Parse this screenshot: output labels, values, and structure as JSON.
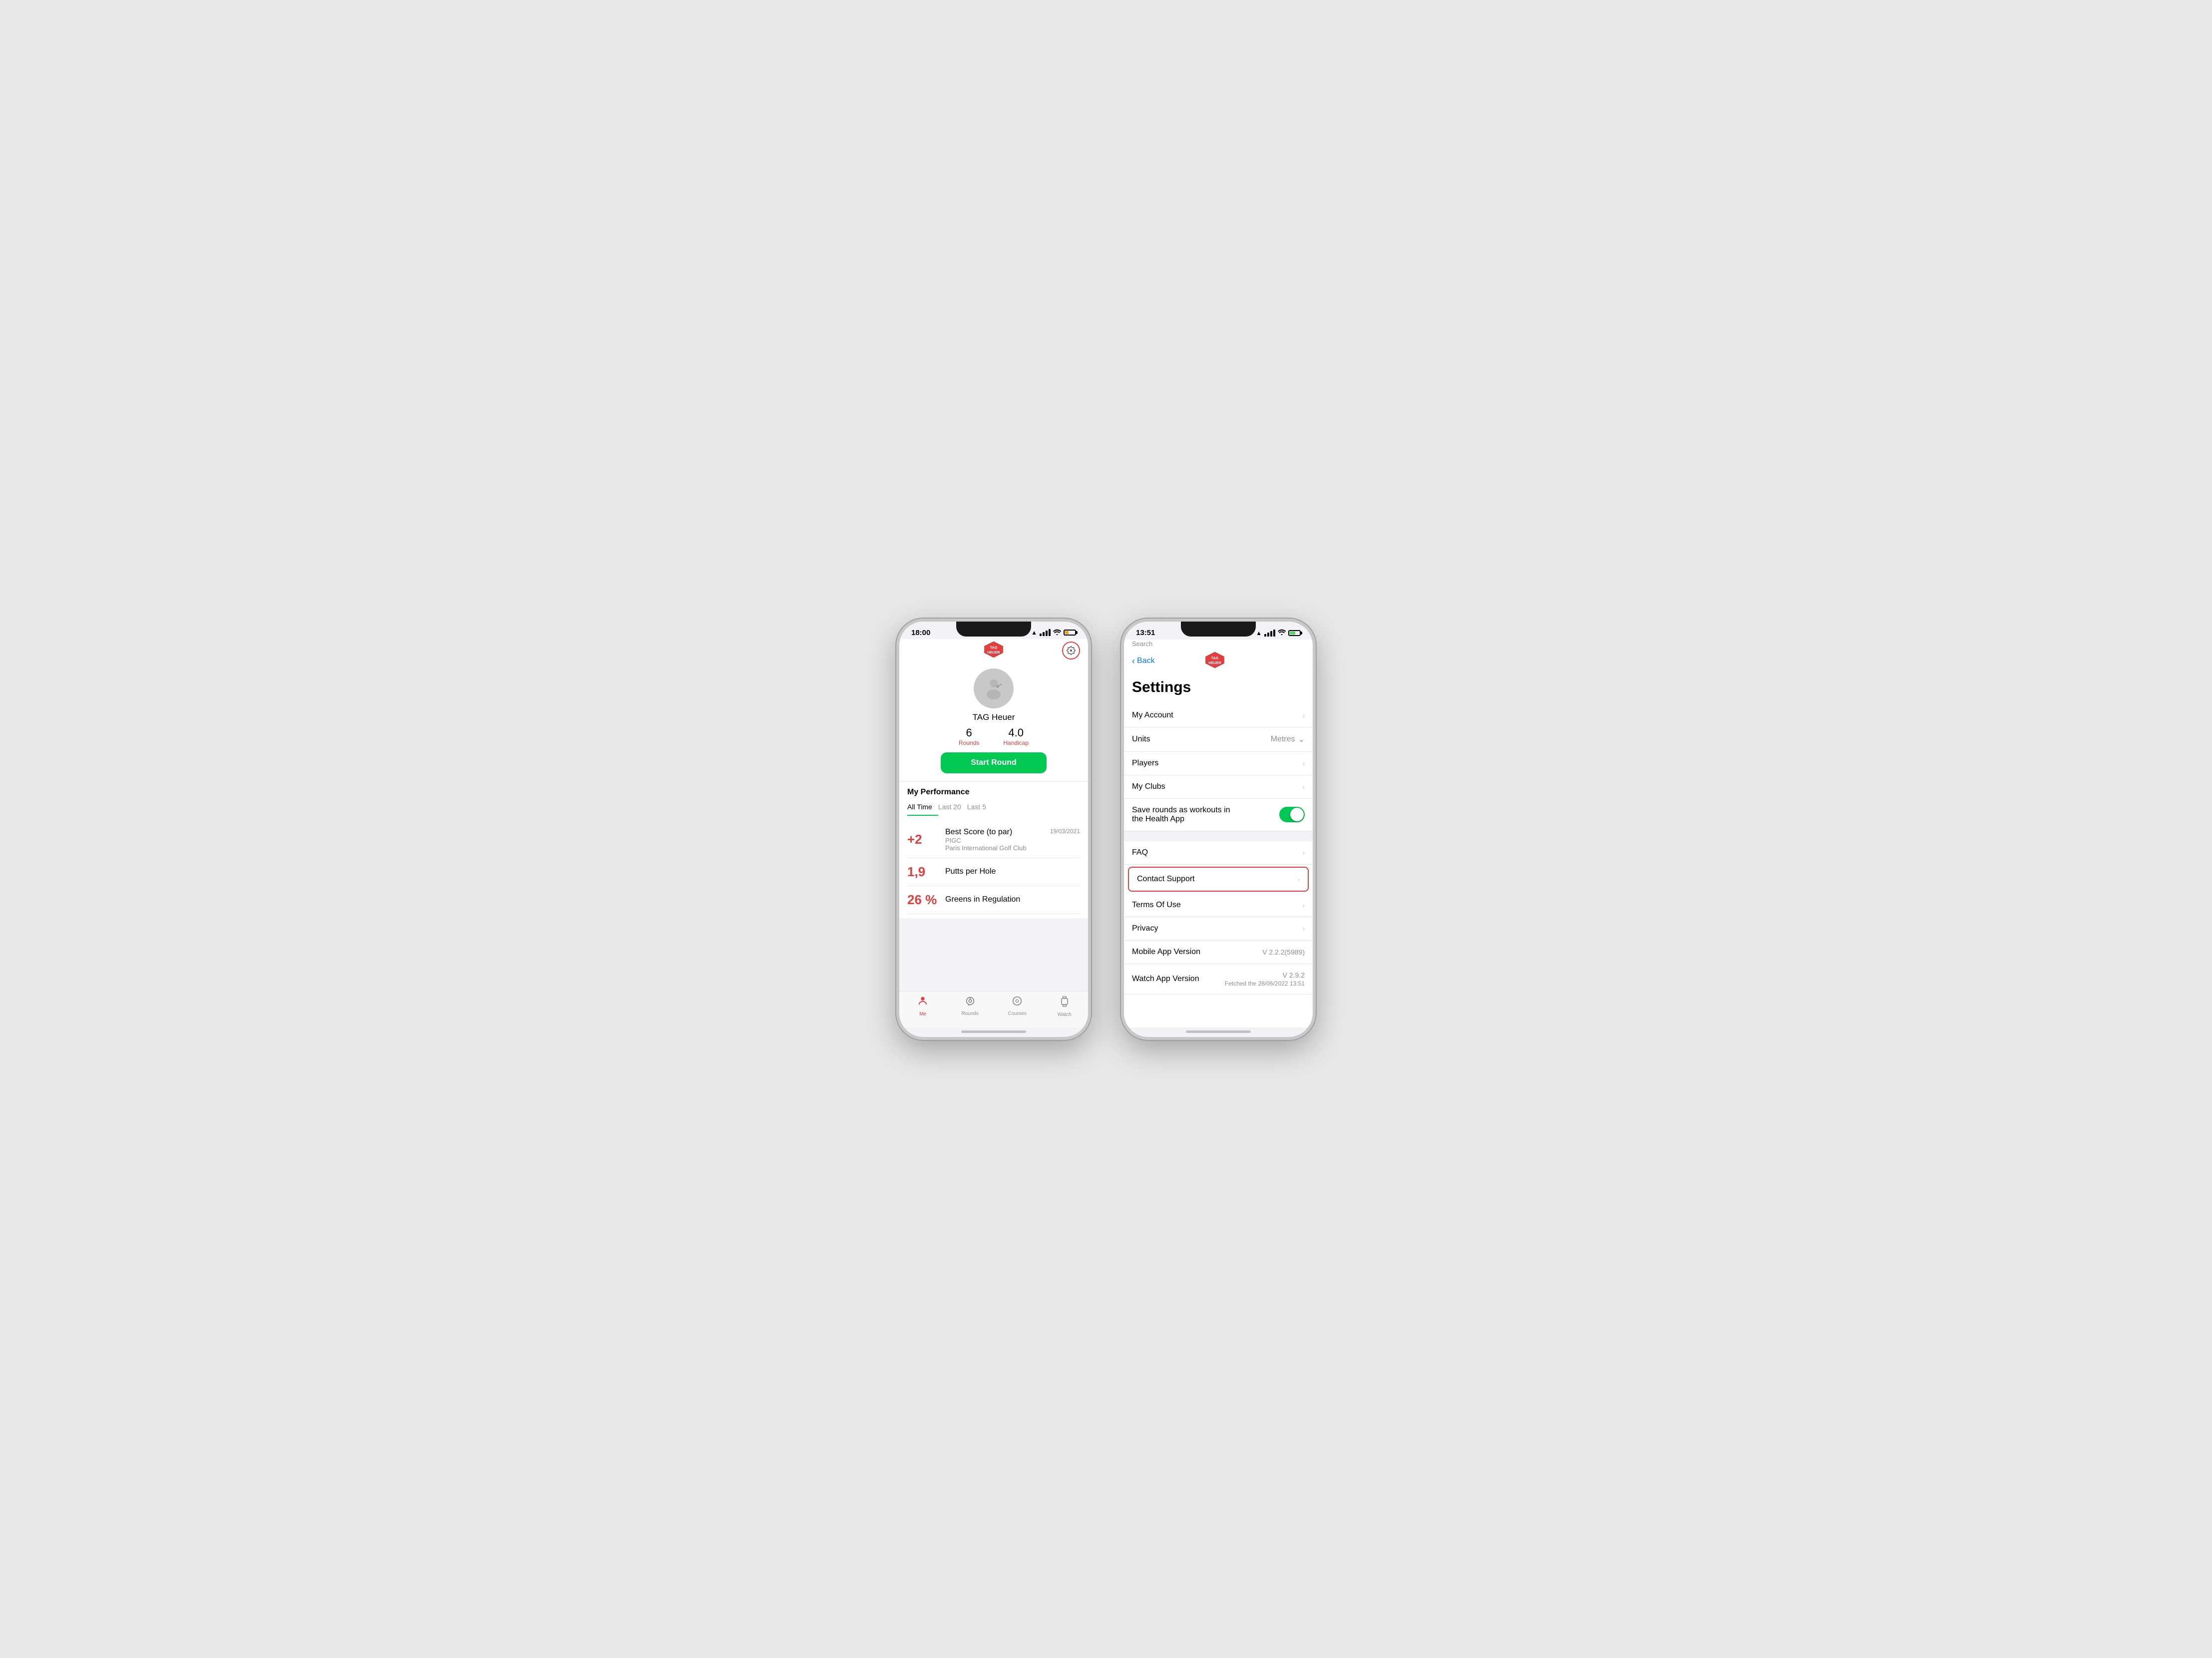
{
  "phone1": {
    "statusBar": {
      "time": "18:00",
      "hasLocation": true
    },
    "header": {
      "title": "TAG Heuer Golf"
    },
    "profile": {
      "name": "TAG Heuer",
      "rounds": "6",
      "roundsLabel": "Rounds",
      "handicap": "4.0",
      "handicapLabel": "Handicap"
    },
    "startRoundBtn": "Start Round",
    "performance": {
      "title": "My Performance",
      "tabs": [
        "All Time",
        "Last 20",
        "Last 5"
      ],
      "activeTab": 0,
      "items": [
        {
          "value": "+2",
          "label": "Best Score (to par)",
          "sublabel": "PIGC",
          "sublabel2": "Paris International Golf Club",
          "date": "19/03/2021"
        },
        {
          "value": "1,9",
          "label": "Putts per Hole",
          "sublabel": "",
          "sublabel2": "",
          "date": ""
        },
        {
          "value": "26 %",
          "label": "Greens in Regulation",
          "sublabel": "",
          "sublabel2": "",
          "date": ""
        }
      ]
    },
    "tabBar": {
      "items": [
        {
          "label": "Me",
          "active": true
        },
        {
          "label": "Rounds",
          "active": false
        },
        {
          "label": "Courses",
          "active": false
        },
        {
          "label": "Watch",
          "active": false
        }
      ]
    }
  },
  "phone2": {
    "statusBar": {
      "time": "13:51",
      "hasLocation": true,
      "backLabel": "Search"
    },
    "nav": {
      "backLabel": "Back"
    },
    "title": "Settings",
    "items": [
      {
        "label": "My Account",
        "value": "",
        "type": "chevron",
        "highlighted": false
      },
      {
        "label": "Units",
        "value": "Metres",
        "type": "dropdown",
        "highlighted": false
      },
      {
        "label": "Players",
        "value": "",
        "type": "chevron",
        "highlighted": false
      },
      {
        "label": "My Clubs",
        "value": "",
        "type": "chevron",
        "highlighted": false
      },
      {
        "label": "Save rounds as workouts in the Health App",
        "value": "",
        "type": "toggle",
        "highlighted": false
      },
      {
        "label": "FAQ",
        "value": "",
        "type": "chevron",
        "highlighted": false
      },
      {
        "label": "Contact Support",
        "value": "",
        "type": "chevron",
        "highlighted": true
      },
      {
        "label": "Terms Of Use",
        "value": "",
        "type": "chevron",
        "highlighted": false
      },
      {
        "label": "Privacy",
        "value": "",
        "type": "chevron",
        "highlighted": false
      },
      {
        "label": "Mobile App Version",
        "value": "V 2.2.2(5989)",
        "type": "text",
        "highlighted": false
      },
      {
        "label": "Watch App Version",
        "value": "V 2.9.2",
        "subvalue": "Fetched the 28/06/2022 13:51",
        "type": "text-sub",
        "highlighted": false
      }
    ]
  }
}
